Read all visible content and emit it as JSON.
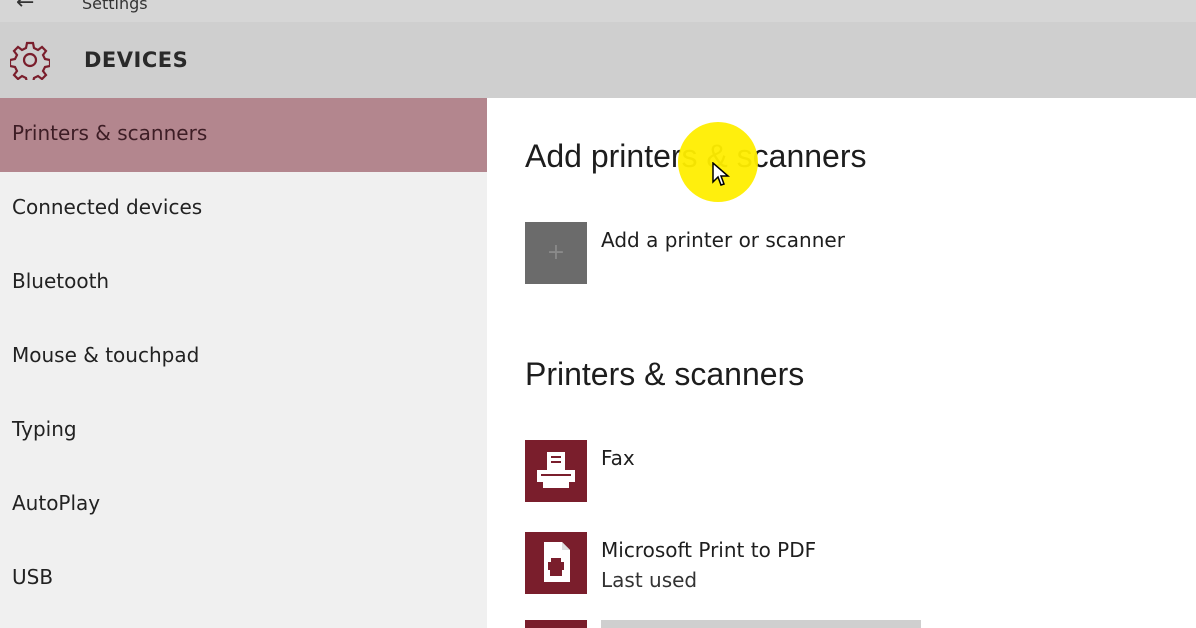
{
  "titlebar": {
    "title": "Settings"
  },
  "header": {
    "title": "DEVICES",
    "icon": "gear-icon"
  },
  "sidebar": {
    "items": [
      {
        "label": "Printers & scanners",
        "selected": true
      },
      {
        "label": "Connected devices",
        "selected": false
      },
      {
        "label": "Bluetooth",
        "selected": false
      },
      {
        "label": "Mouse & touchpad",
        "selected": false
      },
      {
        "label": "Typing",
        "selected": false
      },
      {
        "label": "AutoPlay",
        "selected": false
      },
      {
        "label": "USB",
        "selected": false
      }
    ]
  },
  "main": {
    "add_section": {
      "title": "Add printers & scanners",
      "add_label": "Add a printer or scanner"
    },
    "list_section": {
      "title": "Printers & scanners",
      "printers": [
        {
          "name": "Fax",
          "status": ""
        },
        {
          "name": "Microsoft Print to PDF",
          "status": "Last used"
        }
      ]
    }
  },
  "colors": {
    "accent": "#7a1e2c",
    "selected_nav": "#b3868e",
    "header_bg": "#cfcfcf",
    "sidebar_bg": "#f0f0f0",
    "cursor_highlight": "#ffee00"
  }
}
